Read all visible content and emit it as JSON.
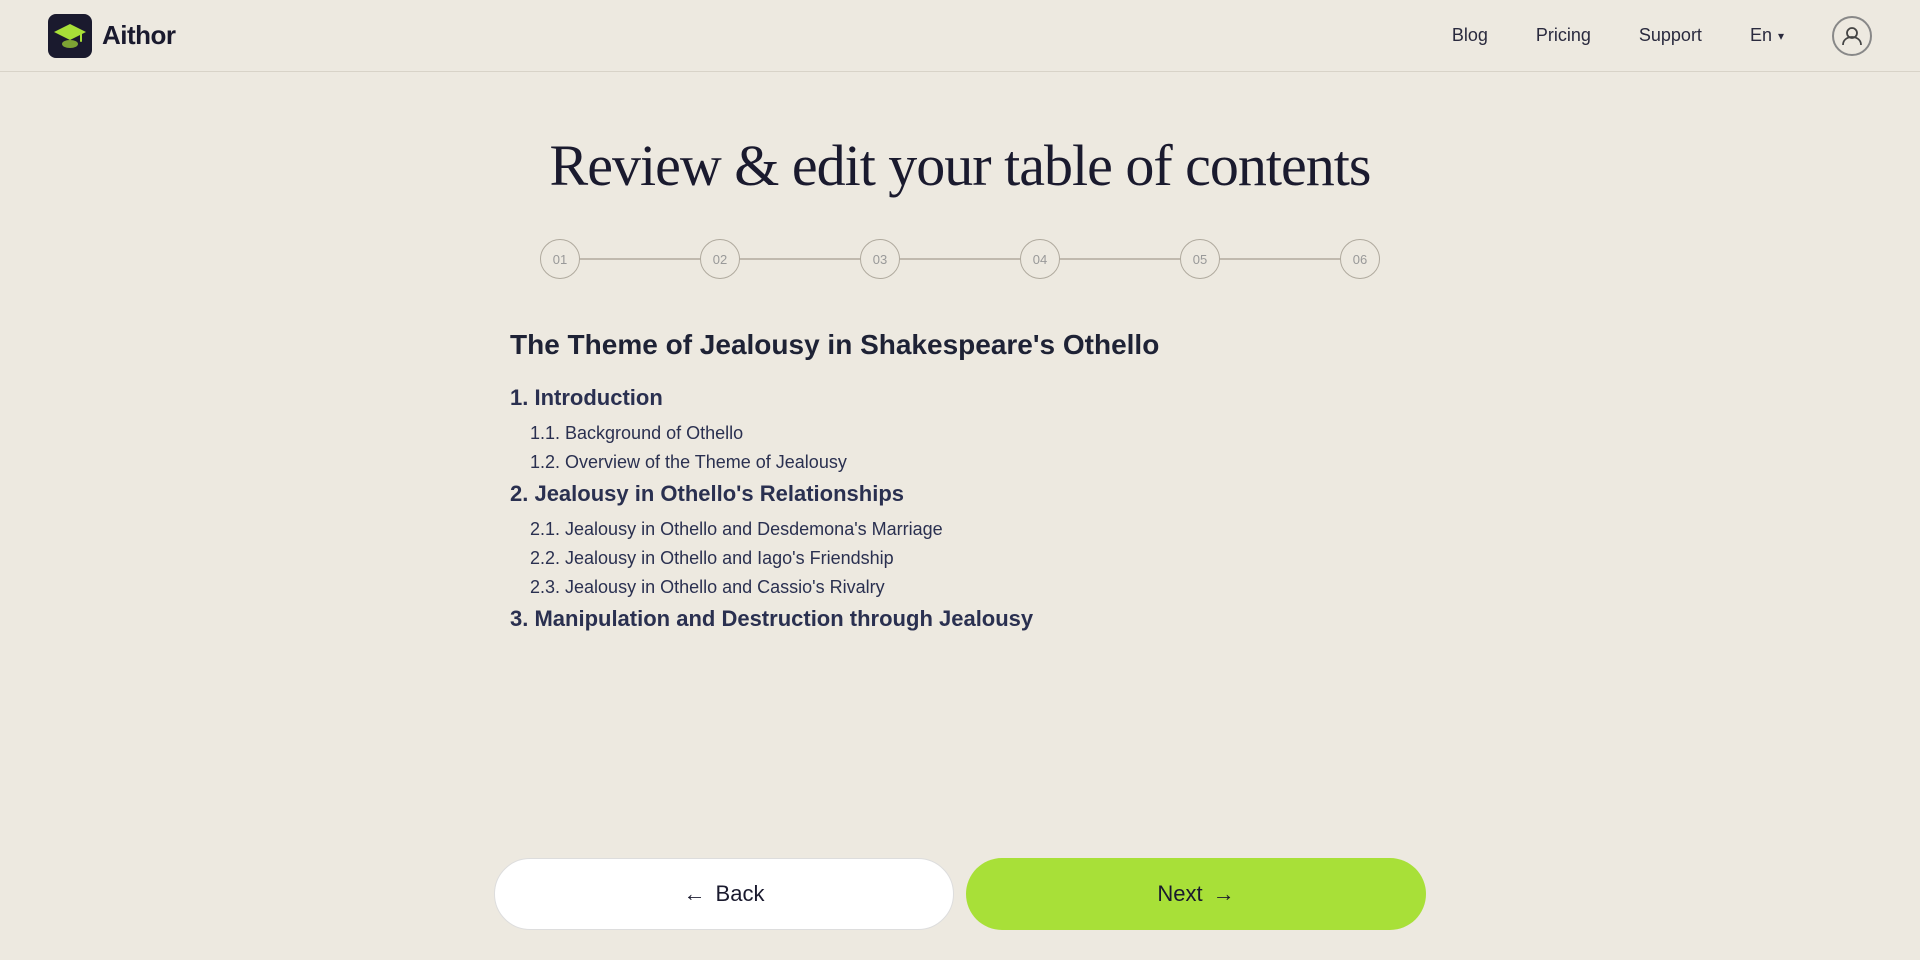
{
  "header": {
    "logo_text": "Aithor",
    "nav": {
      "blog": "Blog",
      "pricing": "Pricing",
      "support": "Support",
      "language": "En"
    }
  },
  "main": {
    "page_title": "Review & edit your table of contents",
    "stepper": {
      "steps": [
        "01",
        "02",
        "03",
        "04",
        "05",
        "06"
      ]
    },
    "toc": {
      "title": "The Theme of Jealousy in Shakespeare's Othello",
      "items": [
        {
          "level": 1,
          "text": "1. Introduction"
        },
        {
          "level": 2,
          "text": "1.1. Background of Othello"
        },
        {
          "level": 2,
          "text": "1.2. Overview of the Theme of Jealousy"
        },
        {
          "level": 1,
          "text": "2. Jealousy in Othello's Relationships"
        },
        {
          "level": 2,
          "text": "2.1. Jealousy in Othello and Desdemona's Marriage"
        },
        {
          "level": 2,
          "text": "2.2. Jealousy in Othello and Iago's Friendship"
        },
        {
          "level": 2,
          "text": "2.3. Jealousy in Othello and Cassio's Rivalry"
        },
        {
          "level": 1,
          "text": "3. Manipulation and Destruction through Jealousy"
        }
      ]
    }
  },
  "footer": {
    "back_label": "Back",
    "next_label": "Next"
  }
}
